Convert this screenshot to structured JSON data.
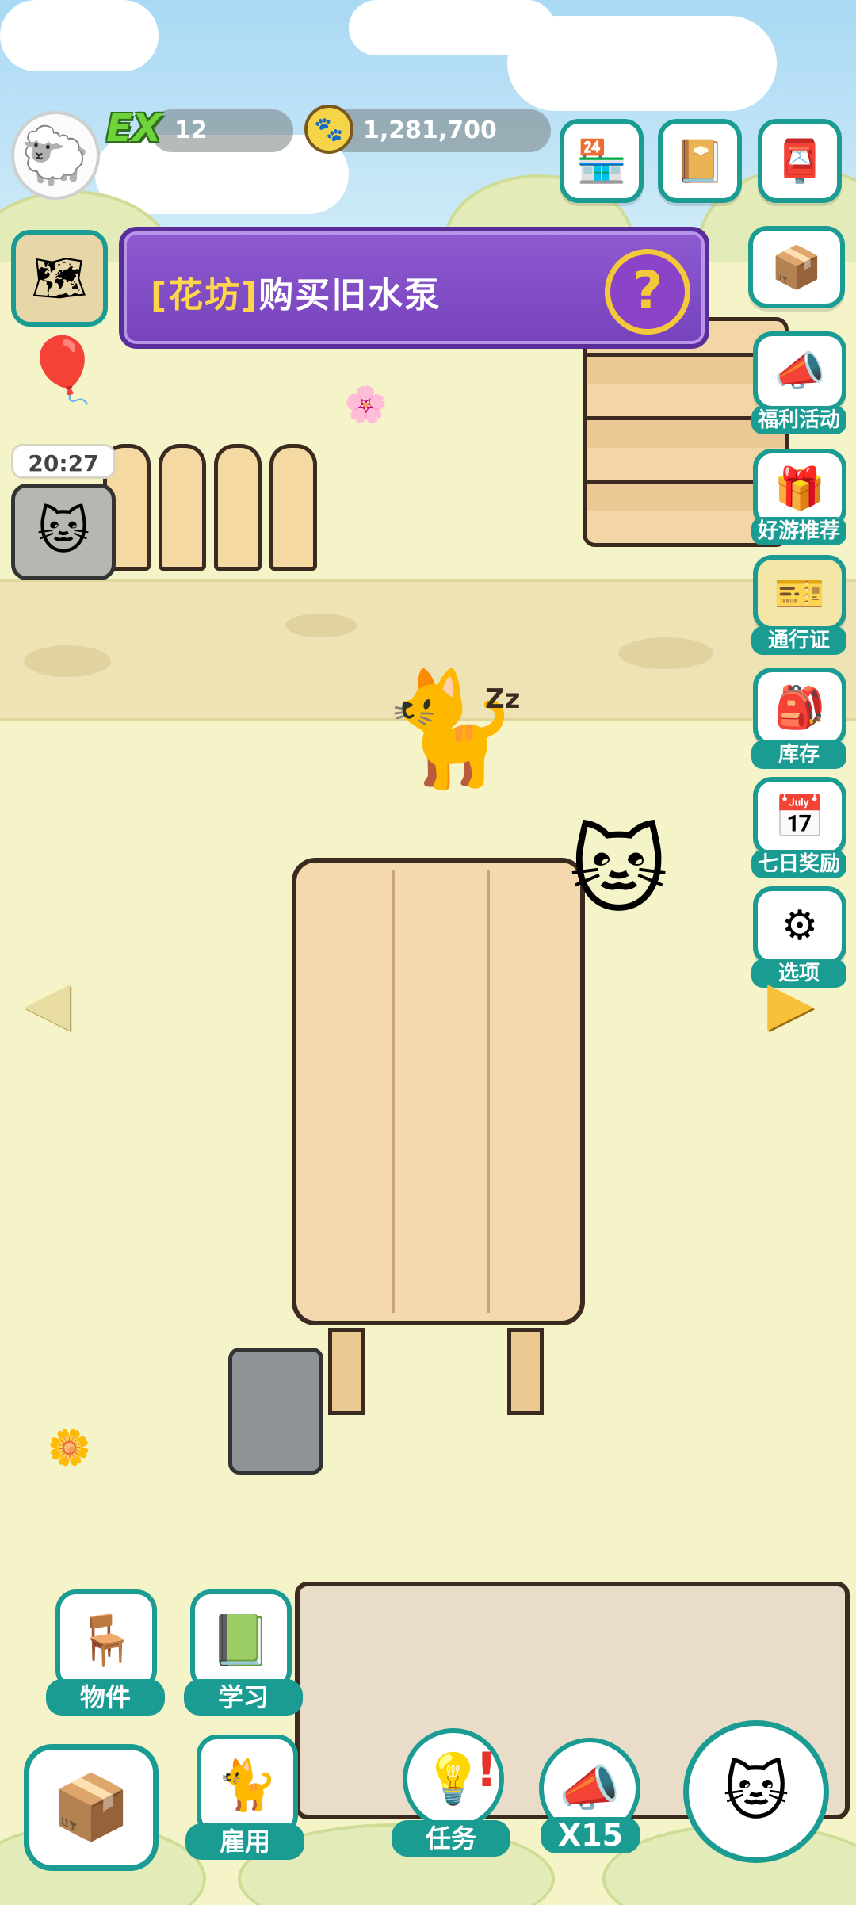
{
  "hud": {
    "ex_badge": "EX",
    "ex_level": "12",
    "coins": "1,281,700"
  },
  "quest": {
    "tag": "[花坊]",
    "text": "购买旧水泵",
    "help": "?"
  },
  "event_timer": "20:27",
  "side_menu": [
    {
      "label": "福利活动",
      "icon": "cat-megaphone-icon"
    },
    {
      "label": "好游推荐",
      "icon": "cat-box-icon"
    },
    {
      "label": "通行证",
      "icon": "pass-ticket-icon"
    },
    {
      "label": "库存",
      "icon": "backpack-icon"
    },
    {
      "label": "七日奖励",
      "icon": "calendar-icon"
    },
    {
      "label": "选项",
      "icon": "gear-icon"
    }
  ],
  "bottom_menu": {
    "items_label": "物件",
    "study_label": "学习",
    "hire_label": "雇用",
    "task_label": "任务",
    "multiplier_label": "X15"
  },
  "colors": {
    "accent": "#1a9c93",
    "quest_bg": "#7643bd",
    "quest_tag": "#ffd54a"
  }
}
